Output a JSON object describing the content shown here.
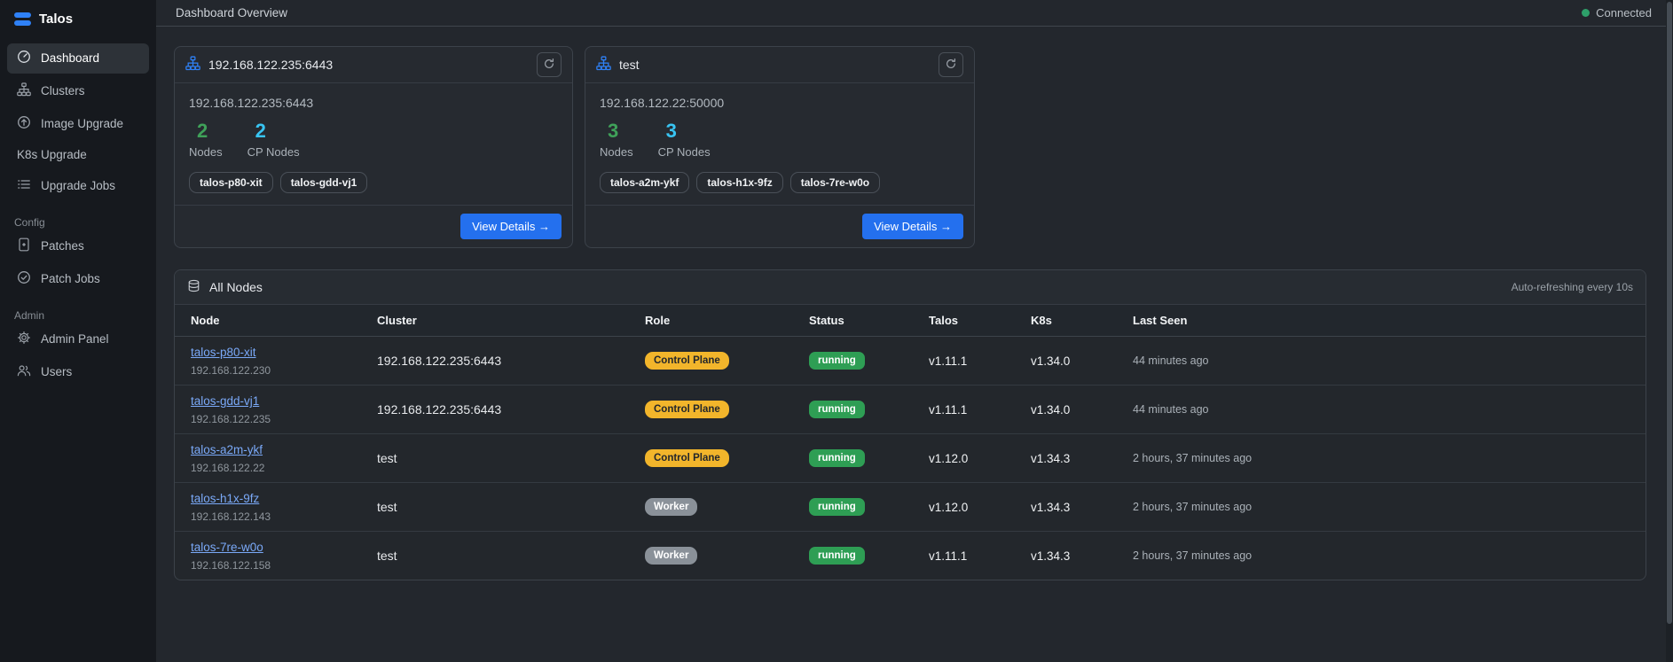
{
  "sidebar": {
    "brand": "Talos",
    "main_items": [
      {
        "label": "Dashboard",
        "icon": "gauge-icon"
      },
      {
        "label": "Clusters",
        "icon": "cluster-diagram-icon"
      },
      {
        "label": "Image Upgrade",
        "icon": "arrow-up-circle-icon"
      },
      {
        "label": "K8s Upgrade",
        "icon": "none"
      },
      {
        "label": "Upgrade Jobs",
        "icon": "list-icon"
      }
    ],
    "sections": [
      {
        "label": "Config",
        "items": [
          {
            "label": "Patches",
            "icon": "journal-icon"
          },
          {
            "label": "Patch Jobs",
            "icon": "patch-check-icon"
          }
        ]
      },
      {
        "label": "Admin",
        "items": [
          {
            "label": "Admin Panel",
            "icon": "gear-icon"
          },
          {
            "label": "Users",
            "icon": "people-icon"
          }
        ]
      }
    ]
  },
  "header": {
    "title": "Dashboard Overview",
    "connection_label": "Connected"
  },
  "clusters": [
    {
      "title": "192.168.122.235:6443",
      "endpoint": "192.168.122.235:6443",
      "nodes_count": "2",
      "nodes_label": "Nodes",
      "cp_nodes_count": "2",
      "cp_nodes_label": "CP Nodes",
      "node_tags": [
        "talos-p80-xit",
        "talos-gdd-vj1"
      ],
      "view_details_label": "View Details →"
    },
    {
      "title": "test",
      "endpoint": "192.168.122.22:50000",
      "nodes_count": "3",
      "nodes_label": "Nodes",
      "cp_nodes_count": "3",
      "cp_nodes_label": "CP Nodes",
      "node_tags": [
        "talos-a2m-ykf",
        "talos-h1x-9fz",
        "talos-7re-w0o"
      ],
      "view_details_label": "View Details →"
    }
  ],
  "all_nodes": {
    "title": "All Nodes",
    "refresh_note": "Auto-refreshing every 10s",
    "columns": [
      "Node",
      "Cluster",
      "Role",
      "Status",
      "Talos",
      "K8s",
      "Last Seen"
    ],
    "rows": [
      {
        "node": "talos-p80-xit",
        "ip": "192.168.122.230",
        "cluster": "192.168.122.235:6443",
        "role": "Control Plane",
        "status": "running",
        "talos": "v1.11.1",
        "k8s": "v1.34.0",
        "last_seen": "44 minutes ago"
      },
      {
        "node": "talos-gdd-vj1",
        "ip": "192.168.122.235",
        "cluster": "192.168.122.235:6443",
        "role": "Control Plane",
        "status": "running",
        "talos": "v1.11.1",
        "k8s": "v1.34.0",
        "last_seen": "44 minutes ago"
      },
      {
        "node": "talos-a2m-ykf",
        "ip": "192.168.122.22",
        "cluster": "test",
        "role": "Control Plane",
        "status": "running",
        "talos": "v1.12.0",
        "k8s": "v1.34.3",
        "last_seen": "2 hours, 37 minutes ago"
      },
      {
        "node": "talos-h1x-9fz",
        "ip": "192.168.122.143",
        "cluster": "test",
        "role": "Worker",
        "status": "running",
        "talos": "v1.12.0",
        "k8s": "v1.34.3",
        "last_seen": "2 hours, 37 minutes ago"
      },
      {
        "node": "talos-7re-w0o",
        "ip": "192.168.122.158",
        "cluster": "test",
        "role": "Worker",
        "status": "running",
        "talos": "v1.11.1",
        "k8s": "v1.34.3",
        "last_seen": "2 hours, 37 minutes ago"
      }
    ]
  },
  "colors": {
    "accent_blue": "#2f81f7",
    "button_blue": "#2470ee",
    "stat_green": "#3fa159",
    "stat_cyan": "#38c4f2",
    "running_badge": "#2e9e54",
    "control_plane_badge": "#f2b52b",
    "worker_badge": "#8a9199",
    "connected_dot": "#2ea06a",
    "node_link": "#7aa9f8"
  }
}
